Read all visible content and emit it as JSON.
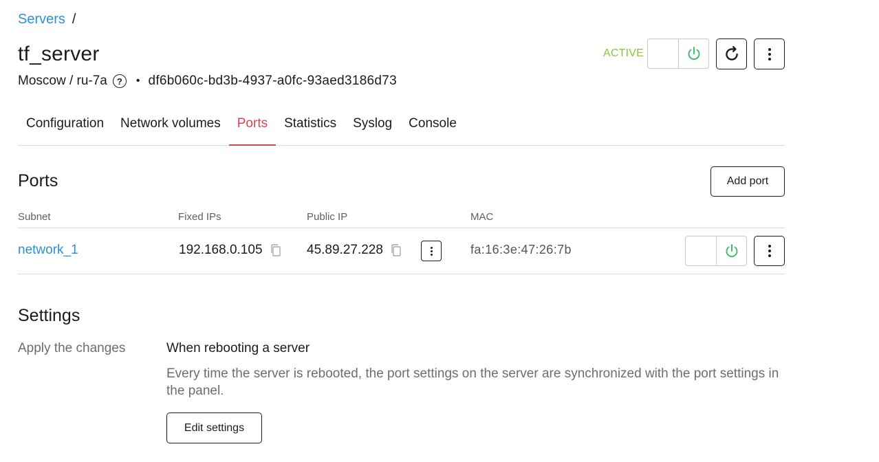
{
  "breadcrumb": {
    "link": "Servers",
    "separator": "/"
  },
  "server": {
    "name": "tf_server",
    "location": "Moscow / ru-7a",
    "help_icon": "?",
    "bullet": "•",
    "id": "df6b060c-bd3b-4937-a0fc-93aed3186d73",
    "status": "ACTIVE"
  },
  "colors": {
    "link": "#2d8fd8",
    "status_active": "#8bc43a",
    "power_on": "#3fbf6e",
    "tab_active": "#d9434b"
  },
  "icons": {
    "power": "power-icon",
    "reboot": "reboot-icon",
    "more": "kebab-menu-icon",
    "copy": "copy-icon",
    "help": "question-circle-icon"
  },
  "tabs": [
    {
      "label": "Configuration",
      "active": false
    },
    {
      "label": "Network volumes",
      "active": false
    },
    {
      "label": "Ports",
      "active": true
    },
    {
      "label": "Statistics",
      "active": false
    },
    {
      "label": "Syslog",
      "active": false
    },
    {
      "label": "Console",
      "active": false
    }
  ],
  "ports": {
    "title": "Ports",
    "add_button": "Add port",
    "columns": {
      "subnet": "Subnet",
      "fixed_ips": "Fixed IPs",
      "public_ip": "Public IP",
      "mac": "MAC"
    },
    "rows": [
      {
        "subnet": "network_1",
        "fixed_ip": "192.168.0.105",
        "public_ip": "45.89.27.228",
        "mac": "fa:16:3e:47:26:7b"
      }
    ]
  },
  "settings": {
    "title": "Settings",
    "label": "Apply the changes",
    "heading": "When rebooting a server",
    "description": "Every time the server is rebooted, the port settings on the server are synchronized with the port settings in the panel.",
    "edit_button": "Edit settings"
  }
}
